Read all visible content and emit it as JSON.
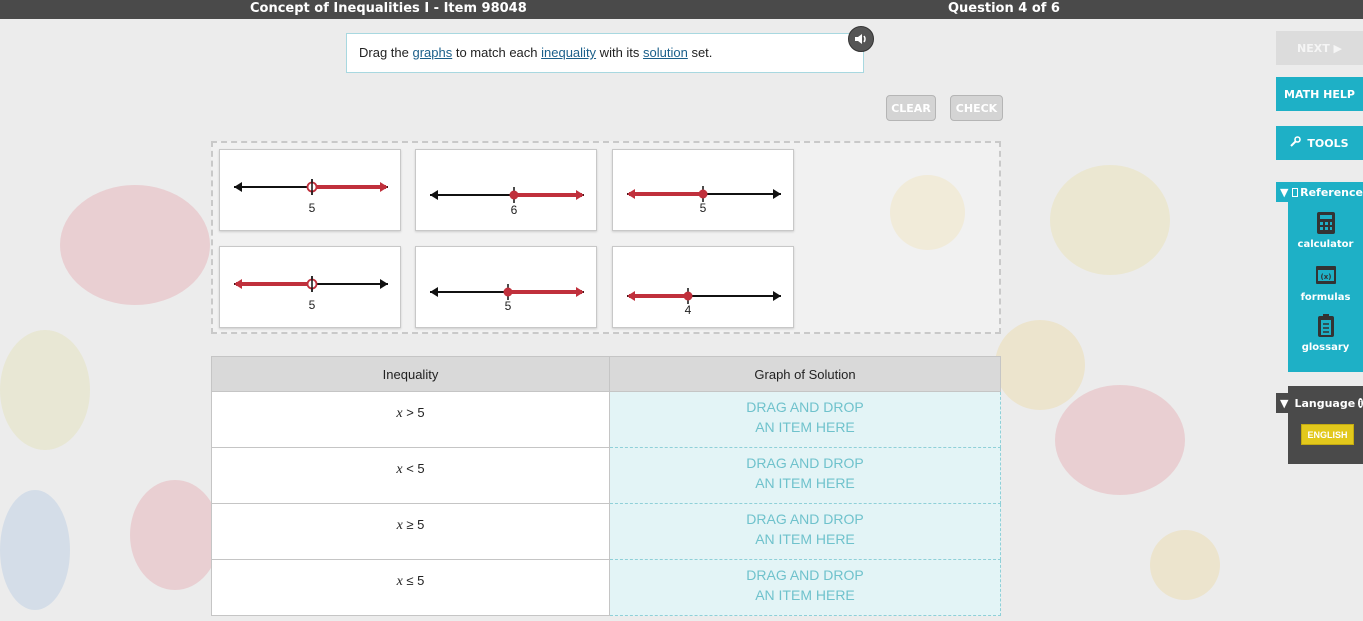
{
  "header": {
    "title": "Concept of Inequalities I - Item 98048",
    "question_counter": "Question 4 of 6"
  },
  "instructions": {
    "pre": "Drag the ",
    "link1": "graphs",
    "mid1": " to match each ",
    "link2": "inequality",
    "mid2": " with its ",
    "link3": "solution",
    "post": " set."
  },
  "toolbar": {
    "clear_label": "CLEAR",
    "check_label": "CHECK"
  },
  "colors": {
    "accent": "#1eb0c6",
    "ray": "#c0303c",
    "axis": "#111111",
    "disabled": "#d4d4d4",
    "language": "#e2c81c"
  },
  "graph_cards": [
    {
      "label": "5",
      "direction": "right",
      "endpoint": "open"
    },
    {
      "label": "6",
      "direction": "right",
      "endpoint": "closed"
    },
    {
      "label": "5",
      "direction": "left",
      "endpoint": "closed"
    },
    {
      "label": "5",
      "direction": "left",
      "endpoint": "open"
    },
    {
      "label": "5",
      "direction": "right",
      "endpoint": "closed"
    },
    {
      "label": "4",
      "direction": "left",
      "endpoint": "closed"
    }
  ],
  "table": {
    "headers": [
      "Inequality",
      "Graph of Solution"
    ],
    "rows": [
      {
        "var": "x",
        "op": " > 5"
      },
      {
        "var": "x",
        "op": " < 5"
      },
      {
        "var": "x",
        "op": " ≥ 5"
      },
      {
        "var": "x",
        "op": " ≤ 5"
      }
    ],
    "drop_line1": "DRAG AND DROP",
    "drop_line2": "AN ITEM HERE"
  },
  "sidebar": {
    "next_label": "NEXT ▶",
    "math_help_label": "MATH HELP",
    "tools_label": "TOOLS",
    "tools_icon": "wrench-icon",
    "reference_label": "Reference",
    "reference_items": [
      {
        "label": "calculator",
        "icon": "calculator-icon"
      },
      {
        "label": "formulas",
        "icon": "formulas-icon"
      },
      {
        "label": "glossary",
        "icon": "glossary-icon"
      }
    ],
    "language_label": "Language",
    "language_value": "ENGLISH"
  }
}
